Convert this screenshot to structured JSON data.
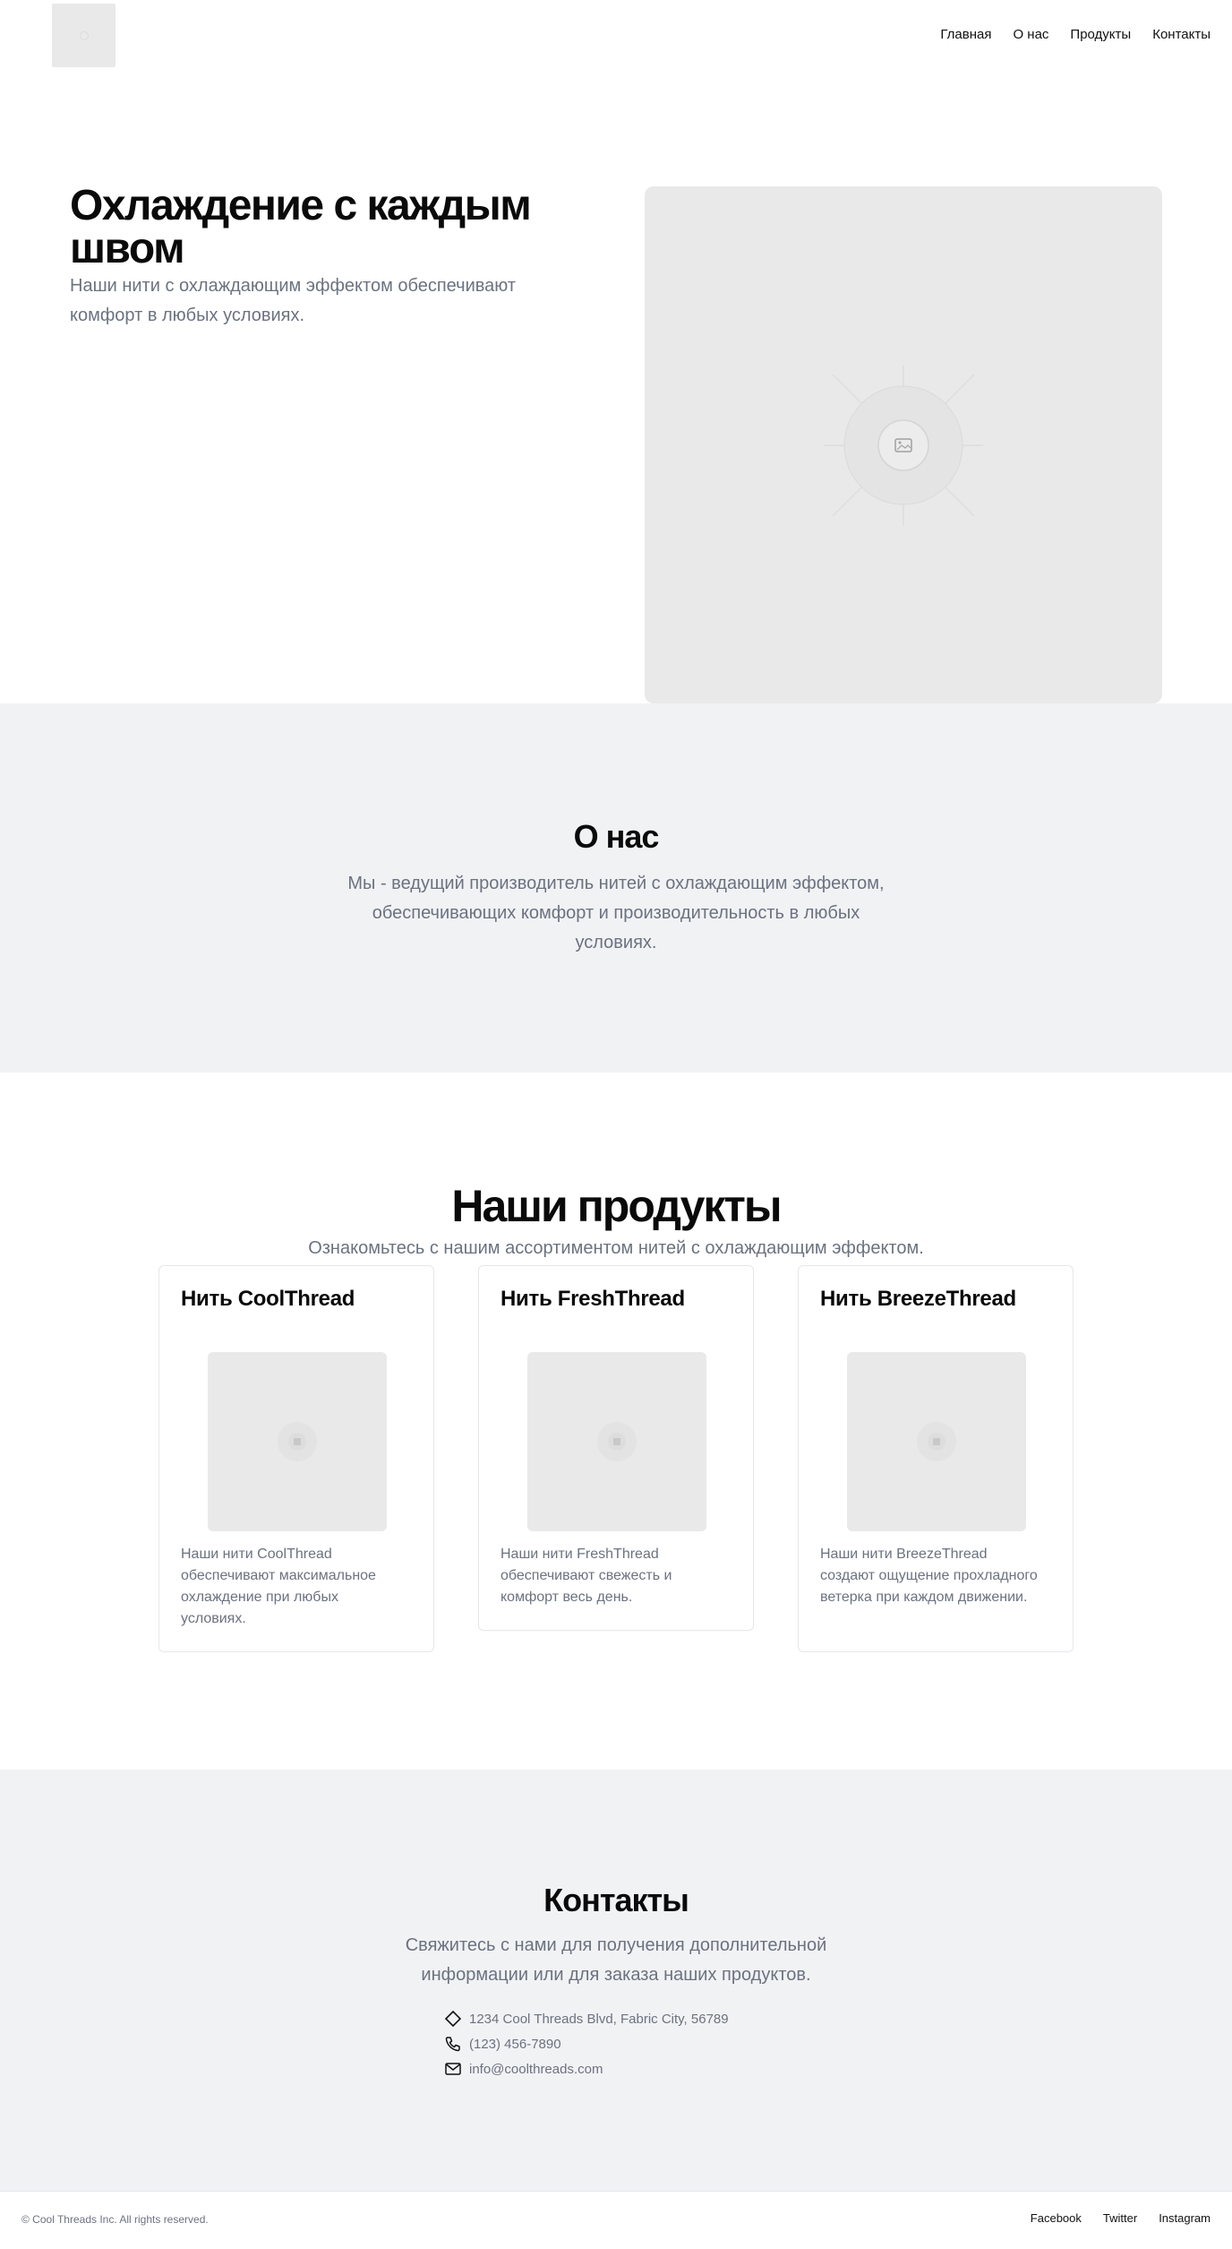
{
  "nav": {
    "items": [
      "Главная",
      "О нас",
      "Продукты",
      "Контакты"
    ]
  },
  "hero": {
    "title": "Охлаждение с каждым швом",
    "subtitle": "Наши нити с охлаждающим эффектом обеспечивают комфорт в любых условиях.",
    "image_icon": "image-placeholder-icon"
  },
  "about": {
    "title": "О нас",
    "text": "Мы - ведущий производитель нитей с охлаждающим эффектом, обеспечивающих комфорт и производительность в любых условиях."
  },
  "products": {
    "title": "Наши продукты",
    "subtitle": "Ознакомьтесь с нашим ассортиментом нитей с охлаждающим эффектом.",
    "items": [
      {
        "title": "Нить CoolThread",
        "text": "Наши нити CoolThread обеспечивают максимальное охлаждение при любых условиях."
      },
      {
        "title": "Нить FreshThread",
        "text": "Наши нити FreshThread обеспечивают свежесть и комфорт весь день."
      },
      {
        "title": "Нить BreezeThread",
        "text": "Наши нити BreezeThread создают ощущение прохладного ветерка при каждом движении."
      }
    ]
  },
  "contacts": {
    "title": "Контакты",
    "text": "Свяжитесь с нами для получения дополнительной информации или для заказа наших продуктов.",
    "address": "1234 Cool Threads Blvd, Fabric City, 56789",
    "phone": "(123) 456-7890",
    "email": "info@coolthreads.com"
  },
  "footer": {
    "copyright": "© Cool Threads Inc. All rights reserved.",
    "links": [
      "Facebook",
      "Twitter",
      "Instagram"
    ]
  },
  "colors": {
    "muted_text": "#6b7280",
    "section_bg": "#f1f2f4",
    "placeholder_bg": "#e9e9e9"
  }
}
